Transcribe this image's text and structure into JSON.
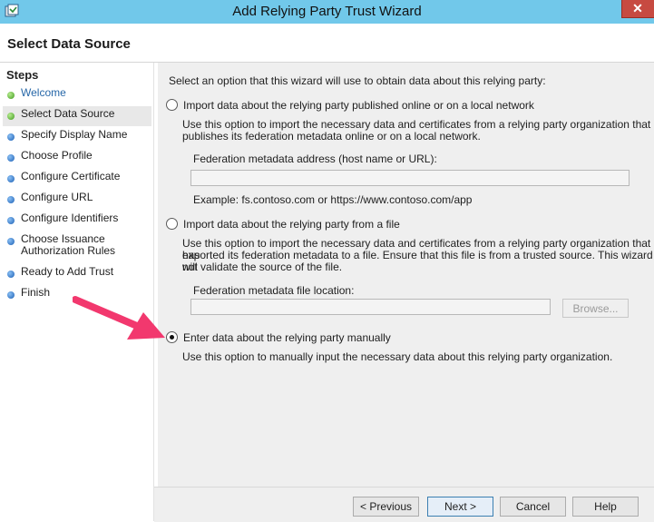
{
  "window": {
    "title": "Add Relying Party Trust Wizard",
    "close_label": "✕"
  },
  "page": {
    "title": "Select Data Source"
  },
  "steps": {
    "heading": "Steps",
    "items": [
      {
        "label": "Welcome",
        "status": "done"
      },
      {
        "label": "Select Data Source",
        "status": "current"
      },
      {
        "label": "Specify Display Name",
        "status": "pending"
      },
      {
        "label": "Choose Profile",
        "status": "pending"
      },
      {
        "label": "Configure Certificate",
        "status": "pending"
      },
      {
        "label": "Configure URL",
        "status": "pending"
      },
      {
        "label": "Configure Identifiers",
        "status": "pending"
      },
      {
        "label": "Choose Issuance",
        "label2": "Authorization Rules",
        "status": "pending"
      },
      {
        "label": "Ready to Add Trust",
        "status": "pending"
      },
      {
        "label": "Finish",
        "status": "pending"
      }
    ]
  },
  "content": {
    "intro": "Select an option that this wizard will use to obtain data about this relying party:",
    "option_online": {
      "label": "Import data about the relying party published online or on a local network",
      "desc_line1": "Use this option to import the necessary data and certificates from a relying party organization that",
      "desc_line2": "publishes its federation metadata online or on a local network.",
      "field_label": "Federation metadata address (host name or URL):",
      "field_value": "",
      "example": "Example: fs.contoso.com or https://www.contoso.com/app"
    },
    "option_file": {
      "label": "Import data about the relying party from a file",
      "desc_line1": "Use this option to import the necessary data and certificates from a relying party organization that has",
      "desc_line2": "exported its federation metadata to a file. Ensure that this file is from a trusted source.  This wizard will",
      "desc_line3": "not validate the source of the file.",
      "field_label": "Federation metadata file location:",
      "field_value": "",
      "browse_label": "Browse..."
    },
    "option_manual": {
      "label": "Enter data about the relying party manually",
      "desc": "Use this option to manually input the necessary data about this relying party organization.",
      "selected": true
    }
  },
  "footer": {
    "previous_label": "< Previous",
    "next_label": "Next >",
    "cancel_label": "Cancel",
    "help_label": "Help"
  },
  "colors": {
    "titlebar": "#71c8ea",
    "close": "#c74a41",
    "annotation_arrow": "#f2386e"
  }
}
